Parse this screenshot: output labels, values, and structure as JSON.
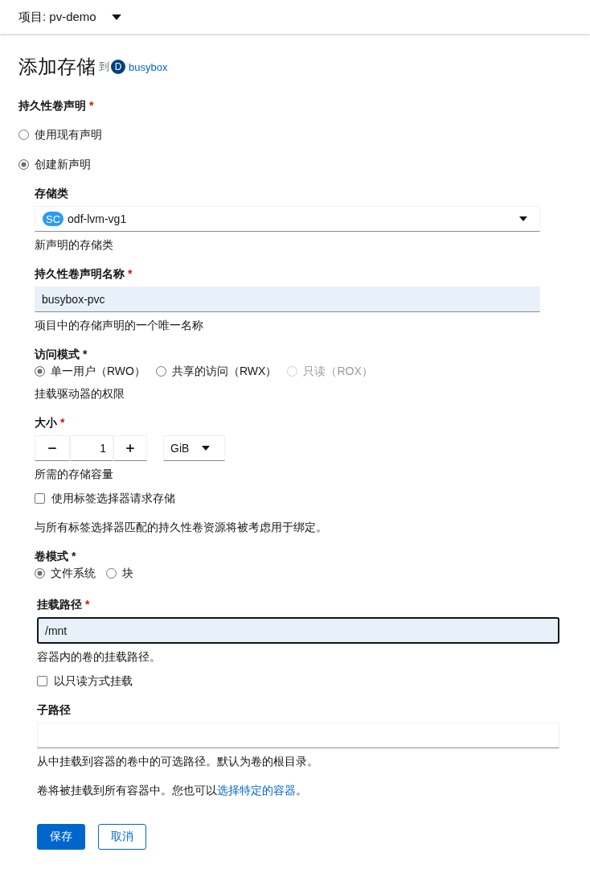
{
  "project_bar": {
    "label": "项目: pv-demo"
  },
  "title": {
    "text": "添加存储",
    "connector": "到",
    "resource_badge": "D",
    "resource_name": "busybox"
  },
  "claim": {
    "label": "持久性卷声明",
    "required_mark": "*",
    "options": [
      {
        "label": "使用现有声明",
        "selected": false
      },
      {
        "label": "创建新声明",
        "selected": true
      }
    ]
  },
  "new_claim": [
    {
      "kind": "select",
      "label": "存储类",
      "badge": "SC",
      "value": "odf-lvm-vg1",
      "helper": "新声明的存储类"
    },
    {
      "kind": "text",
      "label": "持久性卷声明名称",
      "required_mark": "*",
      "value": "busybox-pvc",
      "autofilled": true,
      "focused": false,
      "helper": "项目中的存储声明的一个唯一名称"
    },
    {
      "kind": "radio_group",
      "label": "访问模式 *",
      "options": [
        {
          "label": "单一用户（RWO）",
          "selected": true,
          "disabled": false
        },
        {
          "label": "共享的访问（RWX）",
          "selected": false,
          "disabled": false
        },
        {
          "label": "只读（ROX）",
          "selected": false,
          "disabled": true
        }
      ],
      "helper": "挂载驱动器的权限"
    },
    {
      "kind": "size",
      "label": "大小",
      "required_mark": "*",
      "value": "1",
      "unit": "GiB",
      "helper": "所需的存储容量"
    },
    {
      "kind": "checkbox",
      "label": "使用标签选择器请求存储",
      "checked": false
    },
    {
      "kind": "note",
      "text": "与所有标签选择器匹配的持久性卷资源将被考虑用于绑定。"
    },
    {
      "kind": "radio_group",
      "label": "卷模式 *",
      "options": [
        {
          "label": "文件系统",
          "selected": true,
          "disabled": false
        },
        {
          "label": "块",
          "selected": false,
          "disabled": false
        }
      ]
    }
  ],
  "mount": [
    {
      "kind": "text",
      "label": "挂载路径",
      "required_mark": "*",
      "value": "/mnt",
      "autofilled": true,
      "focused": true,
      "helper": "容器内的卷的挂载路径。"
    },
    {
      "kind": "checkbox",
      "label": "以只读方式挂载",
      "checked": false
    },
    {
      "kind": "text",
      "label": "子路径",
      "autofilled": false,
      "focused": false,
      "helper": "从中挂载到容器的卷中的可选路径。默认为卷的根目录。"
    },
    {
      "kind": "note",
      "text": "卷将被挂载到所有容器中。您也可以",
      "link": "选择特定的容器",
      "suffix": "。"
    }
  ],
  "buttons": [
    {
      "label": "保存",
      "kind": "primary"
    },
    {
      "label": "取消",
      "kind": "secondary"
    }
  ]
}
